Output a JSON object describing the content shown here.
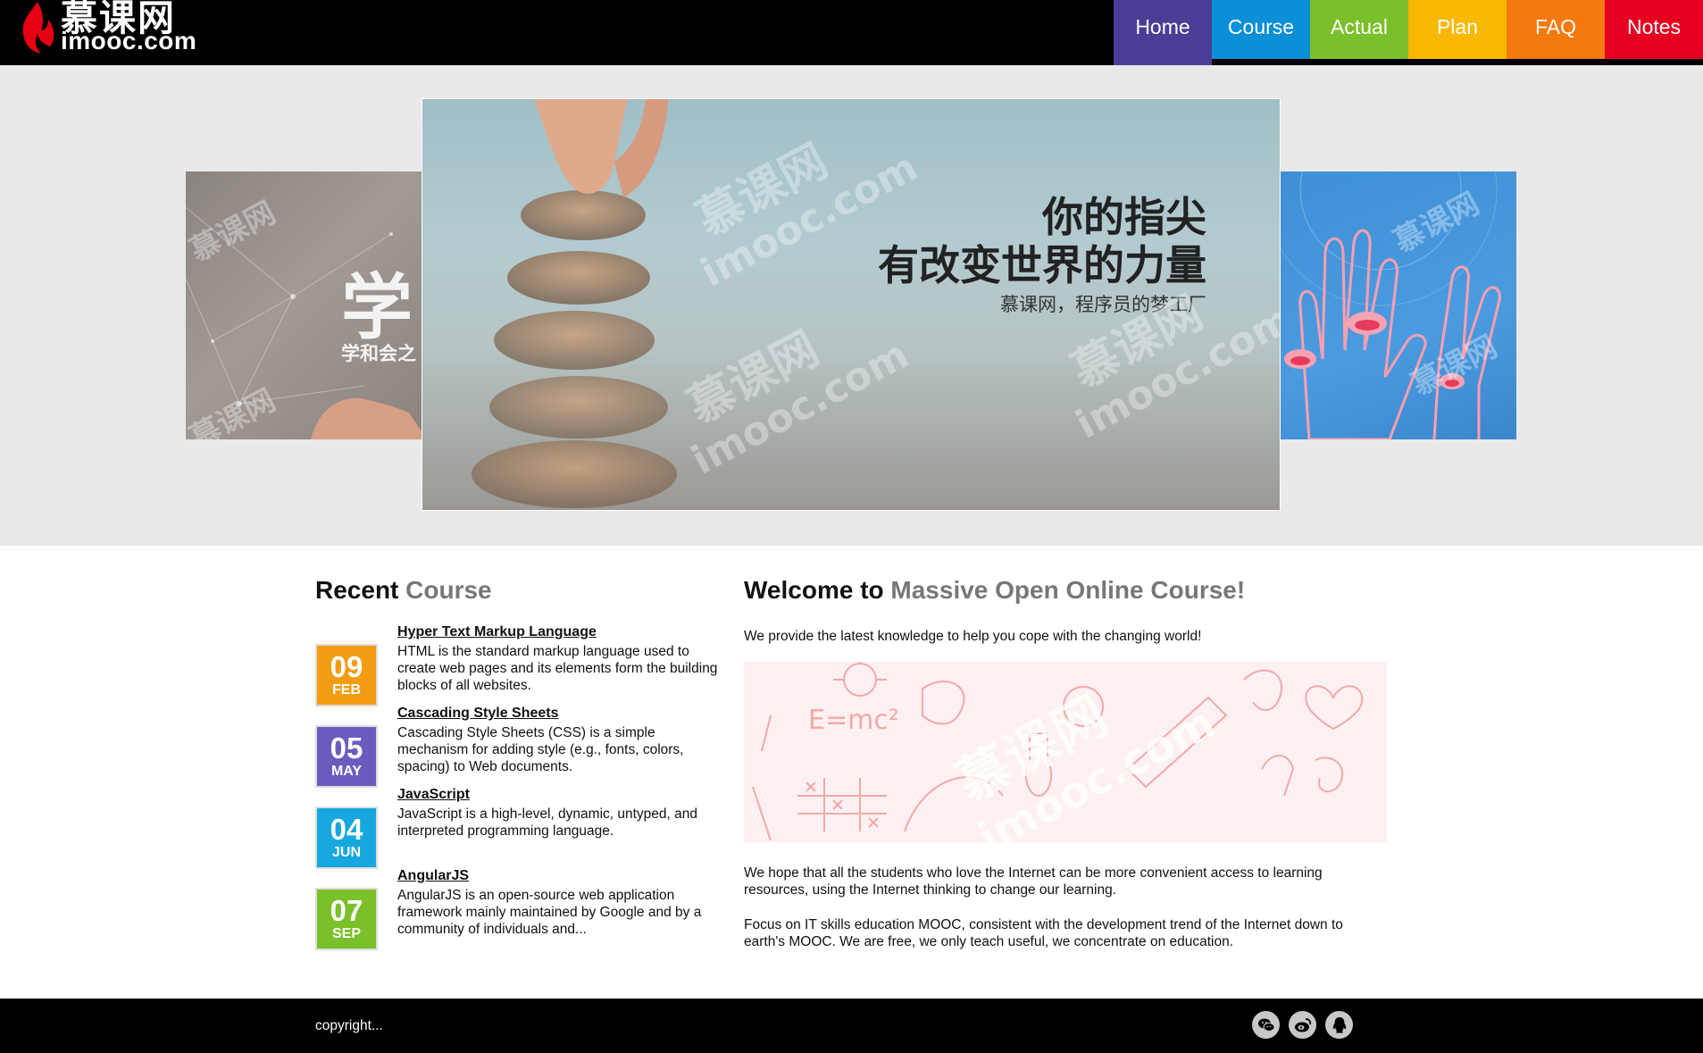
{
  "header": {
    "logo_cn": "慕课网",
    "logo_en": "imooc.com"
  },
  "nav": {
    "items": [
      {
        "label": "Home",
        "color": "#4b3d96"
      },
      {
        "label": "Course",
        "color": "#0b8fd6"
      },
      {
        "label": "Actual",
        "color": "#7ac02a"
      },
      {
        "label": "Plan",
        "color": "#fbb800"
      },
      {
        "label": "FAQ",
        "color": "#f47a0e"
      },
      {
        "label": "Notes",
        "color": "#e5001f"
      }
    ],
    "active": "Home"
  },
  "banner": {
    "center_title_line1": "你的指尖",
    "center_title_line2": "有改变世界的力量",
    "center_subtitle": "慕课网，程序员的梦工厂",
    "left_big": "学",
    "left_small": "学和会之",
    "watermark_cn": "慕课网",
    "watermark_en": "imooc.com"
  },
  "recent": {
    "heading_main": "Recent",
    "heading_accent": "Course",
    "courses": [
      {
        "day": "09",
        "month": "FEB",
        "color": "#f39c12",
        "title": "Hyper Text Markup Language",
        "desc": "HTML is the standard markup language used to create web pages and its elements form the building blocks of all websites."
      },
      {
        "day": "05",
        "month": "MAY",
        "color": "#6b5bbf",
        "title": "Cascading Style Sheets",
        "desc": "Cascading Style Sheets (CSS) is a simple mechanism for adding style (e.g., fonts, colors, spacing) to Web documents."
      },
      {
        "day": "04",
        "month": "JUN",
        "color": "#16a7df",
        "title": "JavaScript",
        "desc": "JavaScript is a high-level, dynamic, untyped, and interpreted programming language."
      },
      {
        "day": "07",
        "month": "SEP",
        "color": "#7ac02a",
        "title": "AngularJS",
        "desc": "AngularJS is an open-source web application framework mainly maintained by Google and by a community of individuals and..."
      }
    ]
  },
  "welcome": {
    "heading_main": "Welcome to",
    "heading_accent": "Massive Open Online Course!",
    "lead": "We provide the latest knowledge to help you cope with the changing world!",
    "p1": "We hope that all the students who love the Internet can be more convenient access to learning resources, using the Internet thinking to change our learning.",
    "p2": "Focus on IT skills education MOOC, consistent with the development trend of the Internet down to earth's MOOC. We are free, we only teach useful, we concentrate on education.",
    "image_text": "E=mc²"
  },
  "footer": {
    "copyright": "copyright...",
    "social_icons": [
      "wechat-icon",
      "weibo-icon",
      "qq-icon"
    ]
  }
}
